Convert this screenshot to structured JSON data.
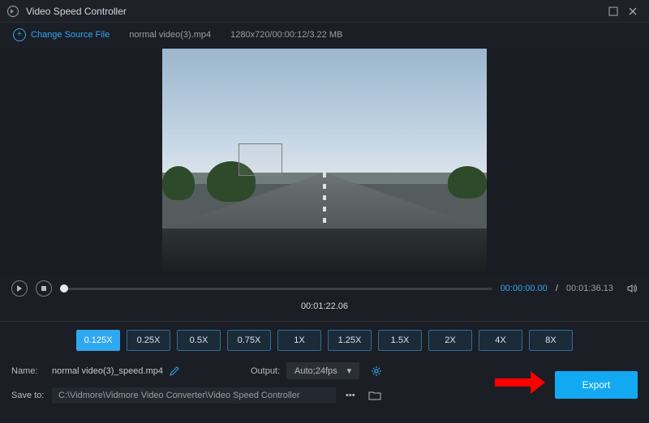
{
  "window": {
    "title": "Video Speed Controller"
  },
  "source": {
    "change_label": "Change Source File",
    "filename": "normal video(3).mp4",
    "meta": "1280x720/00:00:12/3.22 MB"
  },
  "playback": {
    "elapsed_label": "00:01:22.06",
    "current": "00:00:00.00",
    "total": "00:01:36.13"
  },
  "speeds": {
    "options": [
      "0.125X",
      "0.25X",
      "0.5X",
      "0.75X",
      "1X",
      "1.25X",
      "1.5X",
      "2X",
      "4X",
      "8X"
    ],
    "active_index": 0
  },
  "output": {
    "name_label": "Name:",
    "name_value": "normal video(3)_speed.mp4",
    "output_label": "Output:",
    "output_value": "Auto;24fps",
    "saveto_label": "Save to:",
    "saveto_path": "C:\\Vidmore\\Vidmore Video Converter\\Video Speed Controller",
    "export_label": "Export"
  }
}
